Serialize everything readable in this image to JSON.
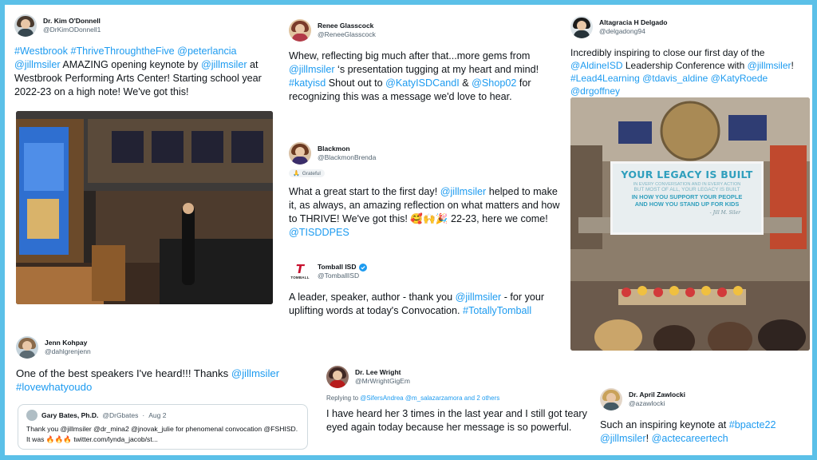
{
  "tweets": {
    "odonnell": {
      "name": "Dr. Kim O'Donnell",
      "handle": "@DrKimODonnell1",
      "parts": [
        {
          "t": "#Westbrook #ThriveThroughtheFive @peterlancia @jillmsiler",
          "link": true
        },
        {
          "t": " AMAZING opening keynote by ",
          "link": false
        },
        {
          "t": "@jillmsiler",
          "link": true
        },
        {
          "t": " at Westbrook Performing Arts Center! Starting school year 2022-23 on a high note! We've got this!",
          "link": false
        }
      ]
    },
    "glasscock": {
      "name": "Renee Glasscock",
      "handle": "@ReneeGlasscock",
      "parts": [
        {
          "t": "Whew, reflecting big much after that...more gems from ",
          "link": false
        },
        {
          "t": "@jillmsiler",
          "link": true
        },
        {
          "t": " ‘s presentation tugging at my heart and mind! ",
          "link": false
        },
        {
          "t": "#katyisd",
          "link": true
        },
        {
          "t": " Shout out to ",
          "link": false
        },
        {
          "t": "@KatyISDCandI",
          "link": true
        },
        {
          "t": " & ",
          "link": false
        },
        {
          "t": "@Shop02",
          "link": true
        },
        {
          "t": " for recognizing this was a message we'd love to hear.",
          "link": false
        }
      ]
    },
    "delgado": {
      "name": "Altagracia H Delgado",
      "handle": "@delgadong94",
      "parts": [
        {
          "t": "Incredibly inspiring to close our first day of the ",
          "link": false
        },
        {
          "t": "@AldineISD",
          "link": true
        },
        {
          "t": " Leadership Conference with ",
          "link": false
        },
        {
          "t": "@jillmsiler",
          "link": true
        },
        {
          "t": "! ",
          "link": false
        },
        {
          "t": "#Lead4Learning @tdavis_aldine @KatyRoede @drgoffney",
          "link": true
        }
      ]
    },
    "blackmon": {
      "name": "Blackmon",
      "handle": "@BlackmonBrenda",
      "badge": "Grateful",
      "parts": [
        {
          "t": "What a great start to the first day! ",
          "link": false
        },
        {
          "t": "@jillmsiler",
          "link": true
        },
        {
          "t": " helped to make it, as always, an amazing reflection on what matters and how to THRIVE! We've got this! 🥰🙌🎉 22-23, here we come! ",
          "link": false
        },
        {
          "t": "@TISDDPES",
          "link": true
        }
      ]
    },
    "tomball": {
      "name": "Tomball ISD",
      "handle": "@TomballISD",
      "logo_letter": "T",
      "logo_word": "TOMBALL",
      "parts": [
        {
          "t": "A leader, speaker, author - thank you ",
          "link": false
        },
        {
          "t": "@jillmsiler",
          "link": true
        },
        {
          "t": " - for your uplifting words at today's Convocation. ",
          "link": false
        },
        {
          "t": "#TotallyTomball",
          "link": true
        }
      ]
    },
    "kohpay": {
      "name": "Jenn Kohpay",
      "handle": "@dahlgrenjenn",
      "parts": [
        {
          "t": "One of the best speakers I've heard!!! Thanks ",
          "link": false
        },
        {
          "t": "@jillmsiler #lovewhatyoudo",
          "link": true
        }
      ],
      "quote": {
        "name": "Gary Bates, Ph.D.",
        "handle": "@DrGbates",
        "sep": "·",
        "date": "Aug 2",
        "text": "Thank you @jillmsiler @dr_mina2 @jnovak_julie for phenomenal convocation @FSHISD.  It was 🔥🔥🔥 twitter.com/lynda_jacob/st..."
      }
    },
    "wright": {
      "name": "Dr. Lee Wright",
      "handle": "@MrWrightGigEm",
      "reply_prefix": "Replying to ",
      "reply_to": "@SifersAndrea @m_salazarzamora and 2 others",
      "parts": [
        {
          "t": "I have heard her 3 times in the last year and I still got teary eyed again today because her message is so powerful.",
          "link": false
        }
      ]
    },
    "zawlocki": {
      "name": "Dr. April Zawlocki",
      "handle": "@azawlocki",
      "parts": [
        {
          "t": "Such an inspiring keynote at ",
          "link": false
        },
        {
          "t": "#bpacte22 @jillmsiler",
          "link": true
        },
        {
          "t": "! ",
          "link": false
        },
        {
          "t": "@actecareertech",
          "link": true
        }
      ]
    }
  },
  "slide": {
    "line1": "YOUR LEGACY IS BUILT",
    "line2": "IN EVERY CONVERSATION AND IN EVERY ACTION",
    "line3": "BUT MOST OF ALL, YOUR LEGACY IS BUILT",
    "line4": "IN HOW YOU SUPPORT YOUR PEOPLE",
    "line5": "AND HOW YOU STAND UP FOR KIDS",
    "sig": "- Jill M. Siler"
  },
  "colors": {
    "link": "#1d9bf0",
    "frame": "#5bc0e8",
    "verified": "#1d9bf0",
    "tomball": "#c8102e"
  },
  "icons": {
    "verified": "verified-badge-icon",
    "grateful": "praying-hands-emoji"
  }
}
